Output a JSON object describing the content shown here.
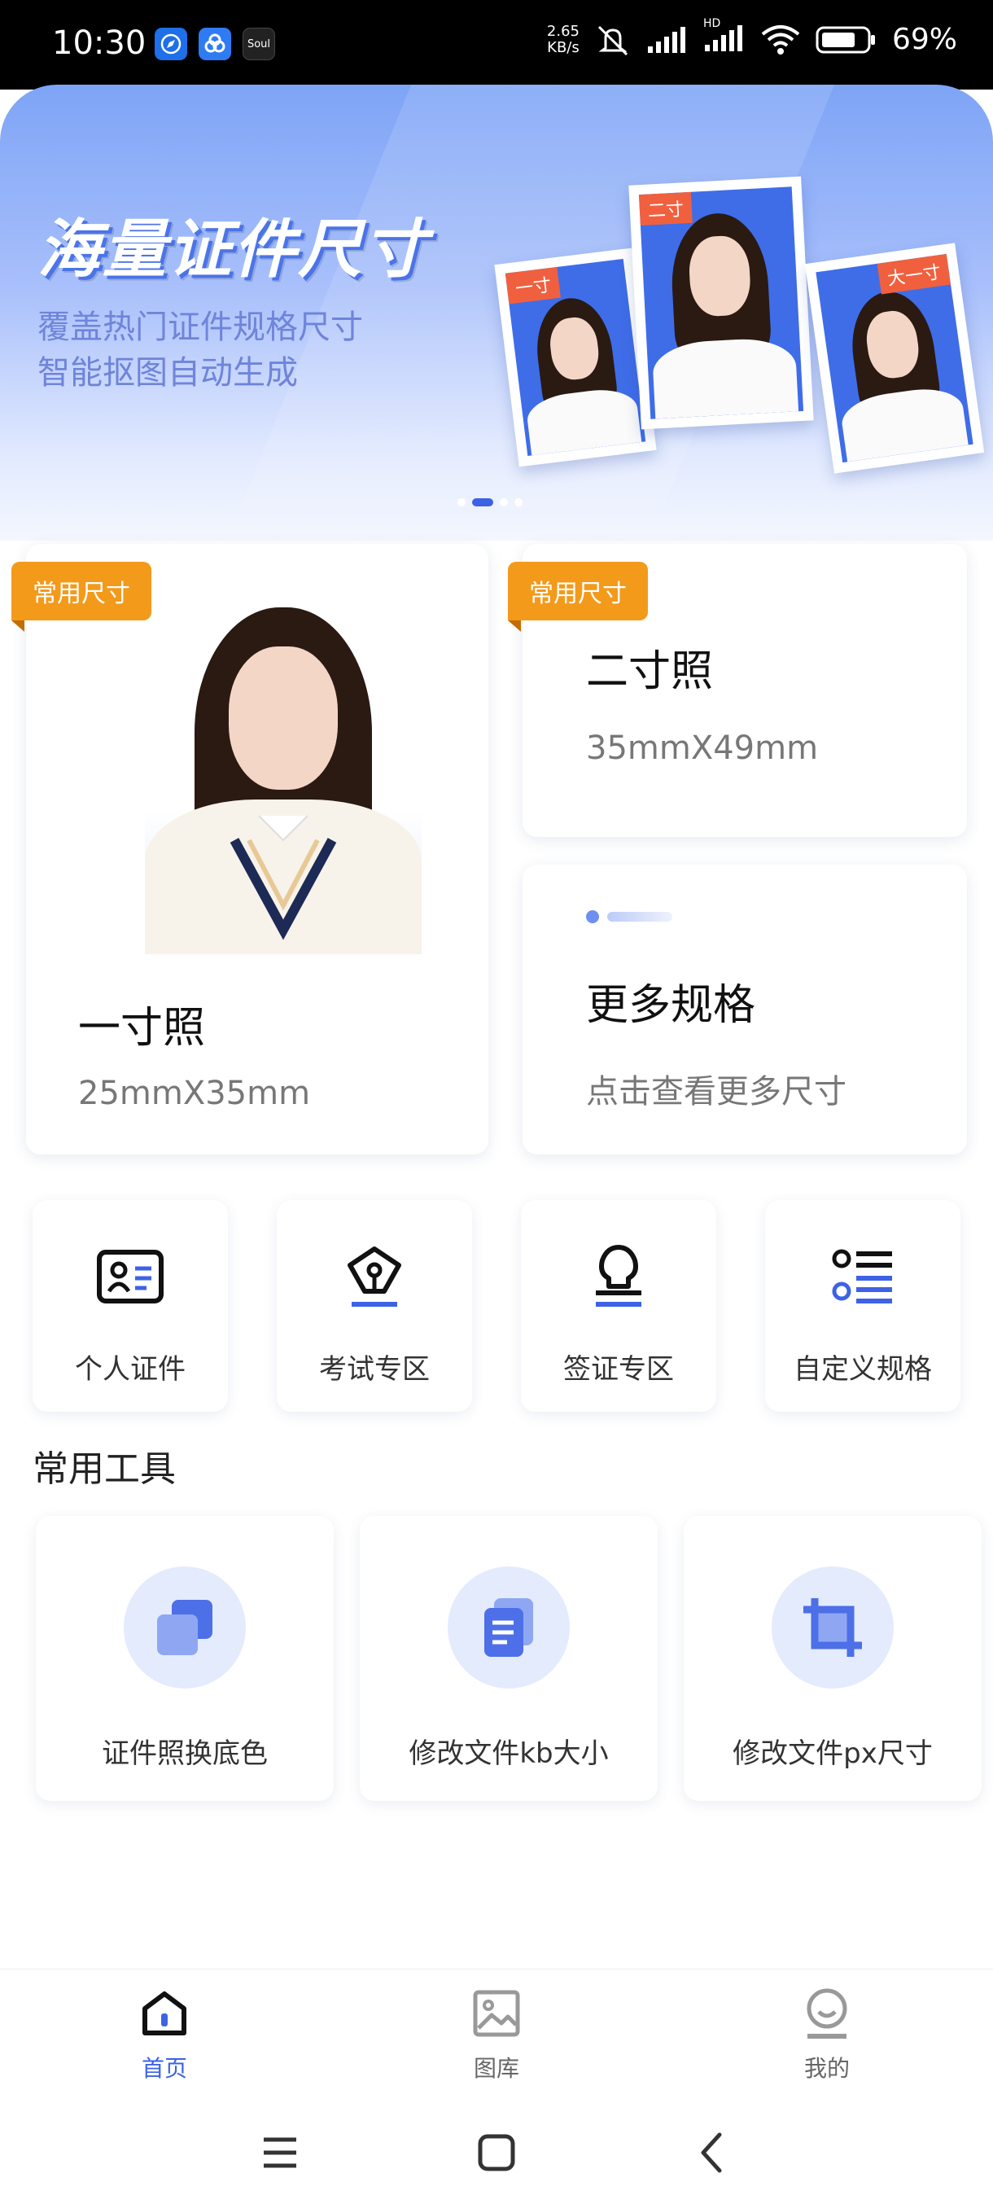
{
  "status_bar": {
    "time": "10:30",
    "app_icons": [
      "compass-app",
      "cloud-app",
      "soul-app"
    ],
    "soul_label": "Soul",
    "net_speed_value": "2.65",
    "net_speed_unit": "KB/s",
    "network_label": "HD",
    "battery": "69%"
  },
  "banner": {
    "title": "海量证件尺寸",
    "subtitle_line1": "覆盖热门证件规格尺寸",
    "subtitle_line2": "智能抠图自动生成",
    "photo_tags": [
      "一寸",
      "二寸",
      "大一寸"
    ],
    "page_count": 4,
    "active_page": 1
  },
  "size_cards": {
    "badge_label": "常用尺寸",
    "one_inch": {
      "title": "一寸照",
      "size": "25mmX35mm"
    },
    "two_inch": {
      "title": "二寸照",
      "size": "35mmX49mm"
    },
    "more": {
      "title": "更多规格",
      "subtitle": "点击查看更多尺寸"
    }
  },
  "categories": [
    {
      "label": "个人证件",
      "icon": "id-card-icon"
    },
    {
      "label": "考试专区",
      "icon": "pen-nib-icon"
    },
    {
      "label": "签证专区",
      "icon": "stamp-icon"
    },
    {
      "label": "自定义规格",
      "icon": "list-icon"
    }
  ],
  "tools_section": {
    "title": "常用工具",
    "items": [
      {
        "label": "证件照换底色",
        "icon": "layers-icon"
      },
      {
        "label": "修改文件kb大小",
        "icon": "file-copy-icon"
      },
      {
        "label": "修改文件px尺寸",
        "icon": "crop-icon"
      }
    ]
  },
  "bottom_nav": {
    "items": [
      {
        "label": "首页",
        "icon": "home-icon",
        "active": true
      },
      {
        "label": "图库",
        "icon": "gallery-icon",
        "active": false
      },
      {
        "label": "我的",
        "icon": "profile-icon",
        "active": false
      }
    ]
  },
  "colors": {
    "accent": "#3d62e6",
    "badge": "#f39a1b",
    "banner_top": "#7ea4f6",
    "photo_bg": "#3f6de8"
  }
}
